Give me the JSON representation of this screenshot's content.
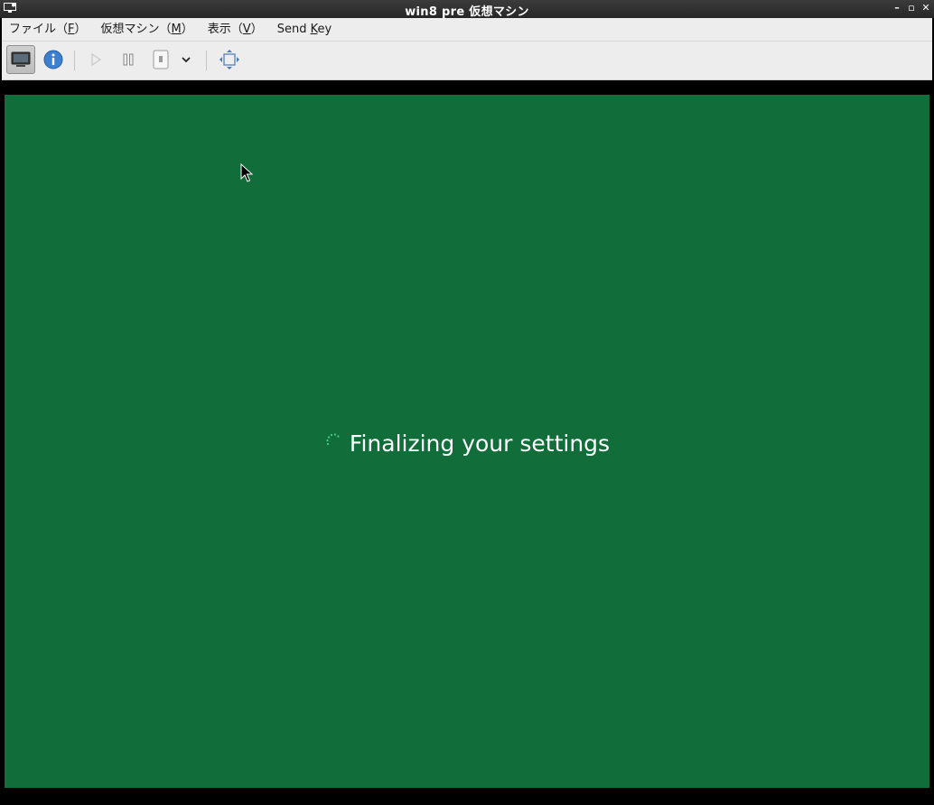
{
  "window": {
    "title": "win8 pre 仮想マシン"
  },
  "menubar": {
    "items": [
      {
        "text": "ファイル（",
        "key": "F",
        "close": "）"
      },
      {
        "text": "仮想マシン（",
        "key": "M",
        "close": "）"
      },
      {
        "text": "表示（",
        "key": "V",
        "close": "）"
      },
      {
        "text": "Send ",
        "key": "K",
        "close": "ey"
      }
    ]
  },
  "toolbar": {
    "buttons": [
      {
        "name": "console-button",
        "icon": "monitor-icon",
        "active": true,
        "enabled": true
      },
      {
        "name": "details-button",
        "icon": "info-icon",
        "active": false,
        "enabled": true
      },
      {
        "name": "run-button",
        "icon": "play-icon",
        "active": false,
        "enabled": false
      },
      {
        "name": "pause-button",
        "icon": "pause-icon",
        "active": false,
        "enabled": true
      },
      {
        "name": "shutdown-button",
        "icon": "power-switch-icon",
        "active": false,
        "enabled": true
      },
      {
        "name": "shutdown-menu-button",
        "icon": "chevron-down-icon",
        "active": false,
        "enabled": true
      },
      {
        "name": "fullscreen-button",
        "icon": "fullscreen-arrows-icon",
        "active": false,
        "enabled": true
      }
    ]
  },
  "guest": {
    "background": "#116d3a",
    "status_text": "Finalizing your settings"
  }
}
